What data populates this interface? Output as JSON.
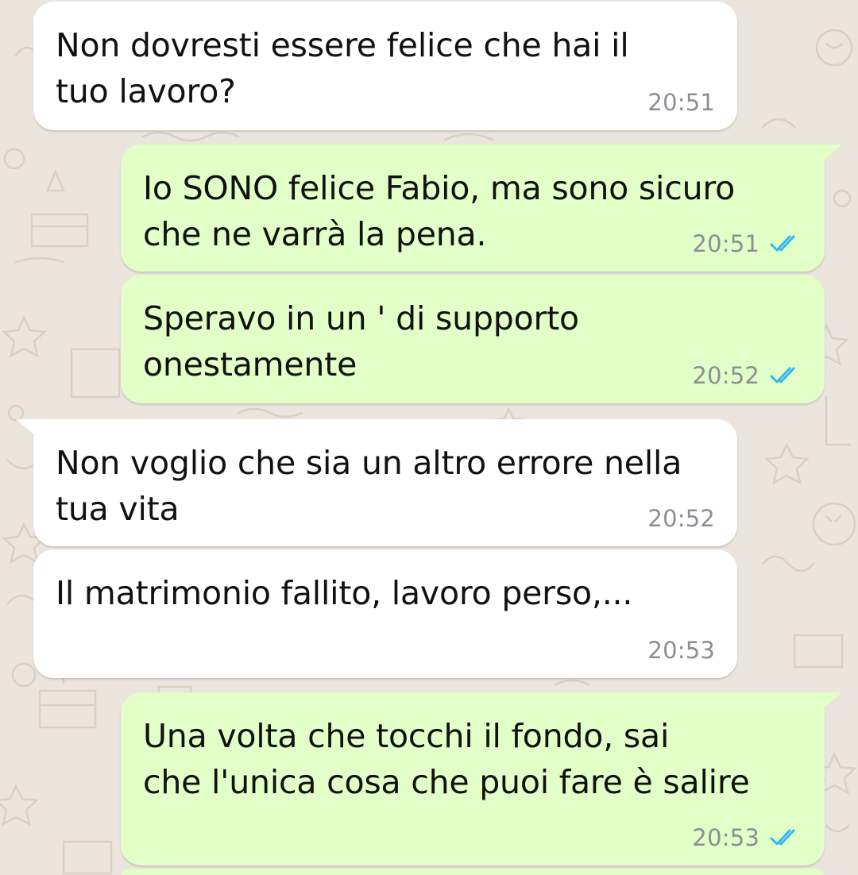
{
  "colors": {
    "background": "#ece5dd",
    "incoming_bubble": "#ffffff",
    "outgoing_bubble": "#e1ffc7",
    "timestamp": "#8a8f94",
    "read_ticks": "#34b7f1"
  },
  "messages": [
    {
      "direction": "incoming",
      "text": "Non dovresti essere felice che hai il\ntuo lavoro?",
      "time": "20:51",
      "status": ""
    },
    {
      "direction": "outgoing",
      "text": "Io SONO felice Fabio, ma sono sicuro\nche ne varrà la pena.",
      "time": "20:51",
      "status": "read-double-check-icon"
    },
    {
      "direction": "outgoing",
      "text": "Speravo in un ' di supporto\nonestamente",
      "time": "20:52",
      "status": "read-double-check-icon"
    },
    {
      "direction": "incoming",
      "text": "Non voglio che sia un altro errore nella\ntua vita",
      "time": "20:52",
      "status": ""
    },
    {
      "direction": "incoming",
      "text": "Il matrimonio fallito, lavoro perso,...",
      "time": "20:53",
      "status": ""
    },
    {
      "direction": "outgoing",
      "text": "Una volta che tocchi il fondo, sai\nche l'unica cosa che puoi fare è salire",
      "time": "20:53",
      "status": "read-double-check-icon"
    }
  ]
}
